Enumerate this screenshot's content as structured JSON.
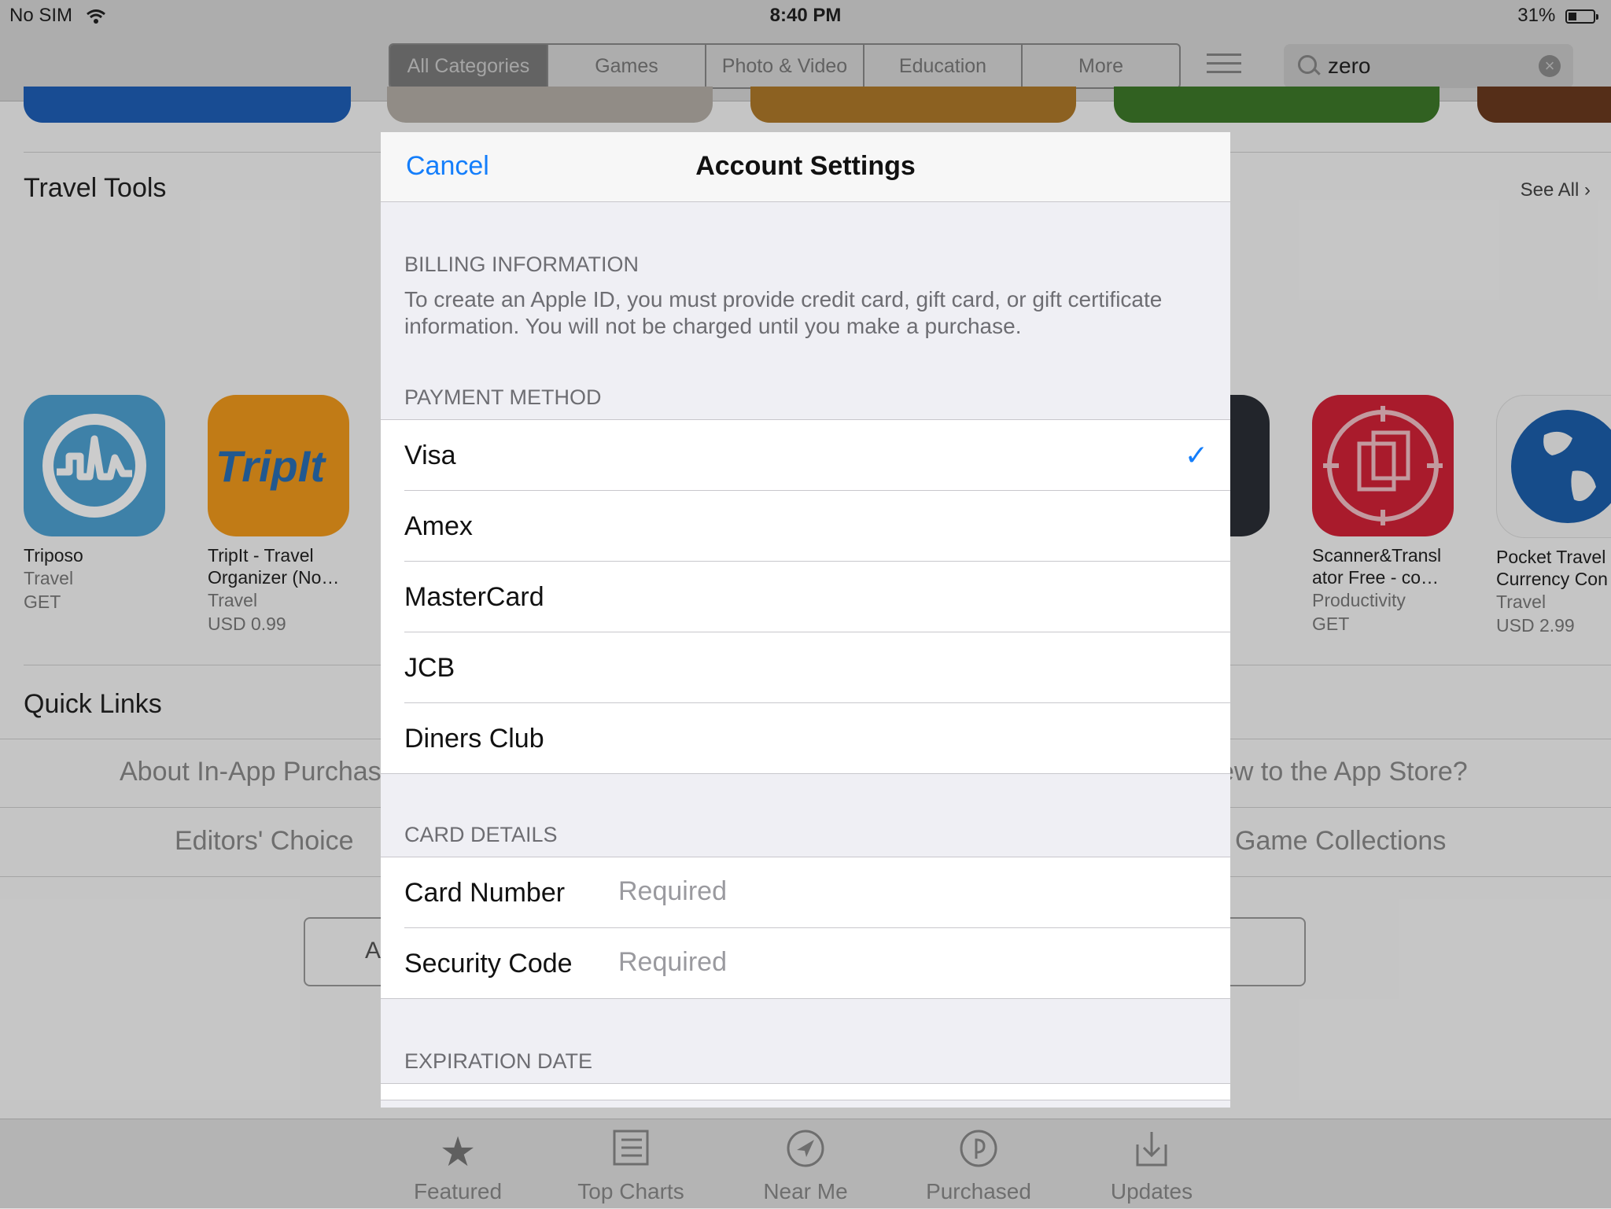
{
  "status_bar": {
    "carrier": "No SIM",
    "time": "8:40 PM",
    "battery": "31%",
    "battery_level": 0.31
  },
  "top_nav": {
    "segments": [
      "All Categories",
      "Games",
      "Photo & Video",
      "Education",
      "More"
    ],
    "search_value": "zero"
  },
  "store": {
    "travel_tools_title": "Travel Tools",
    "see_all": "See All",
    "apps": [
      {
        "name": "Triposo",
        "name2": "",
        "category": "Travel",
        "price": "GET"
      },
      {
        "name": "TripIt - Travel",
        "name2": "Organizer (No…",
        "category": "Travel",
        "price": "USD 0.99"
      },
      {
        "name": "Scanner&Transl",
        "name2": "ator Free - co…",
        "category": "Productivity",
        "price": "GET"
      },
      {
        "name": "Pocket Travel",
        "name2": "Currency Con",
        "category": "Travel",
        "price": "USD 2.99"
      }
    ],
    "tripit_logo": "TripIt",
    "quick_links_title": "Quick Links",
    "quick_links": [
      "About In-App Purchas",
      "ew to the App Store?",
      "Editors' Choice",
      "Game Collections"
    ],
    "partial_button_text": "A"
  },
  "tab_bar": [
    "Featured",
    "Top Charts",
    "Near Me",
    "Purchased",
    "Updates"
  ],
  "modal": {
    "cancel": "Cancel",
    "title": "Account Settings",
    "billing_header": "BILLING INFORMATION",
    "billing_desc": "To create an Apple ID, you must provide credit card, gift card, or gift certificate information. You will not be charged until you make a purchase.",
    "payment_header": "PAYMENT METHOD",
    "payment_methods": [
      "Visa",
      "Amex",
      "MasterCard",
      "JCB",
      "Diners Club"
    ],
    "selected_payment": "Visa",
    "card_header": "CARD DETAILS",
    "card_fields": [
      {
        "label": "Card Number",
        "placeholder": "Required"
      },
      {
        "label": "Security Code",
        "placeholder": "Required"
      }
    ],
    "expiration_header": "EXPIRATION DATE"
  },
  "colors": {
    "accent": "#147efb",
    "tint_check": "#34aadc"
  }
}
